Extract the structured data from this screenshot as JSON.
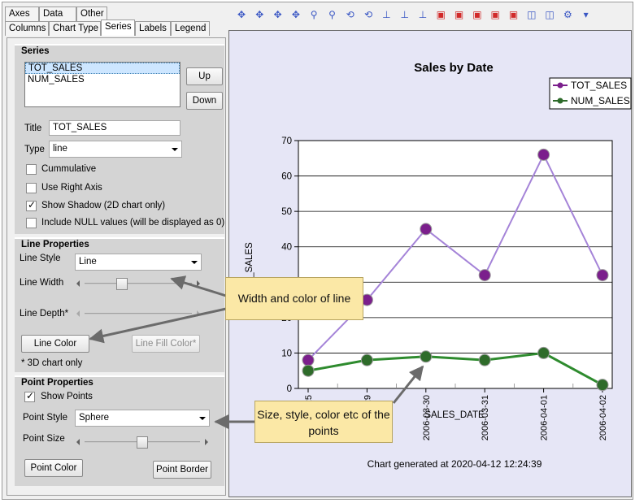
{
  "tabs": {
    "row1": [
      {
        "label": "Axes"
      },
      {
        "label": "Data"
      },
      {
        "label": "Other"
      }
    ],
    "row2": [
      {
        "label": "Columns"
      },
      {
        "label": "Chart Type"
      },
      {
        "label": "Series"
      },
      {
        "label": "Labels"
      },
      {
        "label": "Legend"
      }
    ]
  },
  "series_group": {
    "title": "Series",
    "list": [
      "TOT_SALES",
      "NUM_SALES"
    ],
    "up_label": "Up",
    "down_label": "Down",
    "title_label": "Title",
    "title_value": "TOT_SALES",
    "type_label": "Type",
    "type_value": "line",
    "cumulative": "Cummulative",
    "use_right_axis": "Use Right Axis",
    "show_shadow": "Show Shadow (2D chart only)",
    "include_null": "Include NULL values (will be displayed as 0)"
  },
  "line_group": {
    "title": "Line Properties",
    "style_label": "Line Style",
    "style_value": "Line",
    "width_label": "Line Width",
    "depth_label": "Line Depth*",
    "color_button": "Line Color",
    "fill_button": "Line Fill Color*",
    "footnote": "* 3D chart only",
    "width_level": 0.33
  },
  "point_group": {
    "title": "Point Properties",
    "show_points": "Show Points",
    "style_label": "Point Style",
    "style_value": "Sphere",
    "size_label": "Point Size",
    "color_button": "Point Color",
    "border_button": "Point Border",
    "size_level": 0.5
  },
  "callouts": {
    "line": "Width and color of line",
    "points": "Size, style, color etc of the points"
  },
  "colors": {
    "tot_sales": "#7b1f8c",
    "num_sales": "#2e6b2a",
    "tot_line": "#a584d8",
    "num_line": "#2e8b2e",
    "callout": "#fbe8a6",
    "arrow": "#6b6b6b"
  },
  "chart_data": {
    "type": "line",
    "title": "Sales by Date",
    "xlabel": "SALES_DATE",
    "ylabel": "_SALES",
    "footer": "Chart generated at 2020-04-12 12:24:39",
    "categories": [
      "25",
      "29",
      "2006-03-30",
      "2006-03-31",
      "2006-04-01",
      "2006-04-02"
    ],
    "ylim": [
      0,
      70
    ],
    "yticks": [
      "0",
      "10",
      "20",
      "30",
      "40",
      "50",
      "60",
      "70"
    ],
    "grid": true,
    "legend_position": "top-right",
    "series": [
      {
        "name": "TOT_SALES",
        "values": [
          8,
          25,
          45,
          32,
          66,
          32
        ]
      },
      {
        "name": "NUM_SALES",
        "values": [
          5,
          8,
          9,
          8,
          10,
          1
        ]
      }
    ]
  }
}
